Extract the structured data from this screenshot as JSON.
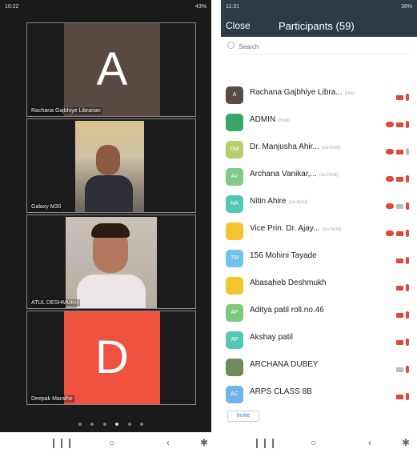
{
  "left": {
    "status": {
      "time": "10:22",
      "battery": "43%"
    },
    "tiles": [
      {
        "type": "avatar",
        "letter": "A",
        "label": "Rachana Gajbhiye Librarian",
        "color": "#5a4a43"
      },
      {
        "type": "video",
        "label": "Galaxy M30"
      },
      {
        "type": "video",
        "label": "ATUL DESHMUKH"
      },
      {
        "type": "avatar",
        "letter": "D",
        "label": "Deepak Marathe",
        "color": "#ef5340"
      }
    ]
  },
  "right": {
    "status": {
      "time": "11:31",
      "battery": "38%"
    },
    "close_label": "Close",
    "title": "Participants (59)",
    "search_placeholder": "Search",
    "participants": [
      {
        "initials": "A",
        "name": "Rachana Gajbhiye Libra...",
        "tag": "(me)",
        "color": "#5a4a43",
        "host_cloud": false,
        "cam": "on",
        "mic": "on"
      },
      {
        "initials": "",
        "name": "ADMIN",
        "tag": "(host)",
        "color": "#3aa56b",
        "host_cloud": true,
        "cam": "on",
        "mic": "on"
      },
      {
        "initials": "DM",
        "name": "Dr. Manjusha Ahir...",
        "tag": "(co-host)",
        "color": "#b6cf6c",
        "host_cloud": true,
        "cam": "on",
        "mic": "off"
      },
      {
        "initials": "AV",
        "name": "Archana Vanikar,...",
        "tag": "(co-host)",
        "color": "#7fc98a",
        "host_cloud": true,
        "cam": "on",
        "mic": "on"
      },
      {
        "initials": "NA",
        "name": "Nitin Ahire",
        "tag": "(co-host)",
        "color": "#53c7b3",
        "host_cloud": true,
        "cam": "off",
        "mic": "on"
      },
      {
        "initials": "",
        "name": "Vice Prin. Dr. Ajay...",
        "tag": "(co-host)",
        "color": "#f4c430",
        "host_cloud": true,
        "cam": "on",
        "mic": "on"
      },
      {
        "initials": "TM",
        "name": "156 Mohini Tayade",
        "tag": "",
        "color": "#6fc3ea",
        "host_cloud": false,
        "cam": "on",
        "mic": "on"
      },
      {
        "initials": "",
        "name": "Abasaheb Deshmukh",
        "tag": "",
        "color": "#f4c430",
        "host_cloud": false,
        "cam": "on",
        "mic": "on"
      },
      {
        "initials": "AP",
        "name": "Aditya patil roll.no.46",
        "tag": "",
        "color": "#7cc97b",
        "host_cloud": false,
        "cam": "on",
        "mic": "on"
      },
      {
        "initials": "AP",
        "name": "Akshay patil",
        "tag": "",
        "color": "#53c7b3",
        "host_cloud": false,
        "cam": "on",
        "mic": "on"
      },
      {
        "initials": "",
        "name": "ARCHANA DUBEY",
        "tag": "",
        "color": "#6f8a5b",
        "host_cloud": false,
        "cam": "off",
        "mic": "on"
      },
      {
        "initials": "AC",
        "name": "ARPS CLASS 8B",
        "tag": "",
        "color": "#6fb3e8",
        "host_cloud": false,
        "cam": "on",
        "mic": "on"
      }
    ],
    "invite_label": "Invite"
  }
}
